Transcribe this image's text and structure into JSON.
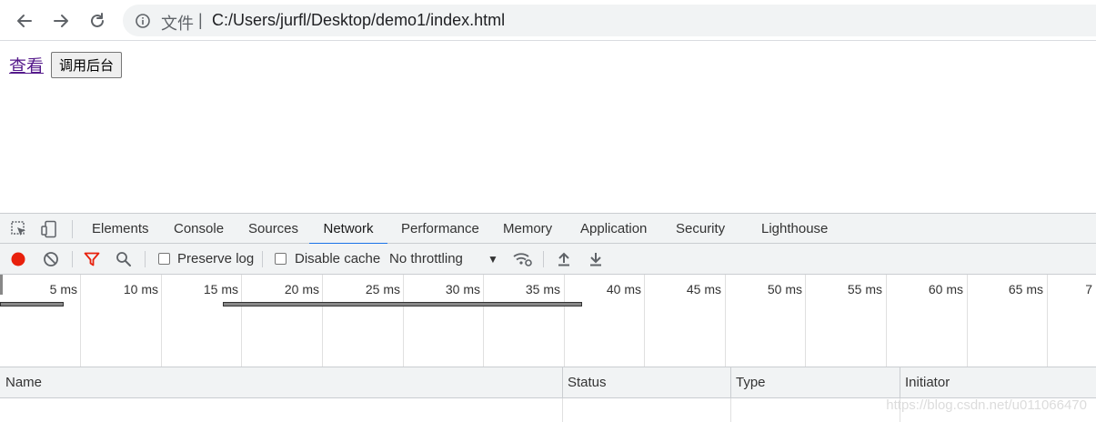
{
  "browser": {
    "address_chip": "文件",
    "address_sep": "|",
    "url": "C:/Users/jurfl/Desktop/demo1/index.html"
  },
  "page": {
    "link_label": "查看",
    "button_label": "调用后台"
  },
  "devtools": {
    "tabs": [
      "Elements",
      "Console",
      "Sources",
      "Network",
      "Performance",
      "Memory",
      "Application",
      "Security",
      "Lighthouse"
    ],
    "active_tab": "Network",
    "toolbar": {
      "preserve_log": "Preserve log",
      "disable_cache": "Disable cache",
      "throttling": "No throttling"
    },
    "timeline_ticks": [
      "5 ms",
      "10 ms",
      "15 ms",
      "20 ms",
      "25 ms",
      "30 ms",
      "35 ms",
      "40 ms",
      "45 ms",
      "50 ms",
      "55 ms",
      "60 ms",
      "65 ms",
      "7"
    ],
    "columns": [
      "Name",
      "Status",
      "Type",
      "Initiator"
    ],
    "colors": {
      "record": "#e8200c",
      "filter": "#e8200c",
      "active_tab_underline": "#1a73e8"
    }
  },
  "watermark": "https://blog.csdn.net/u011066470"
}
